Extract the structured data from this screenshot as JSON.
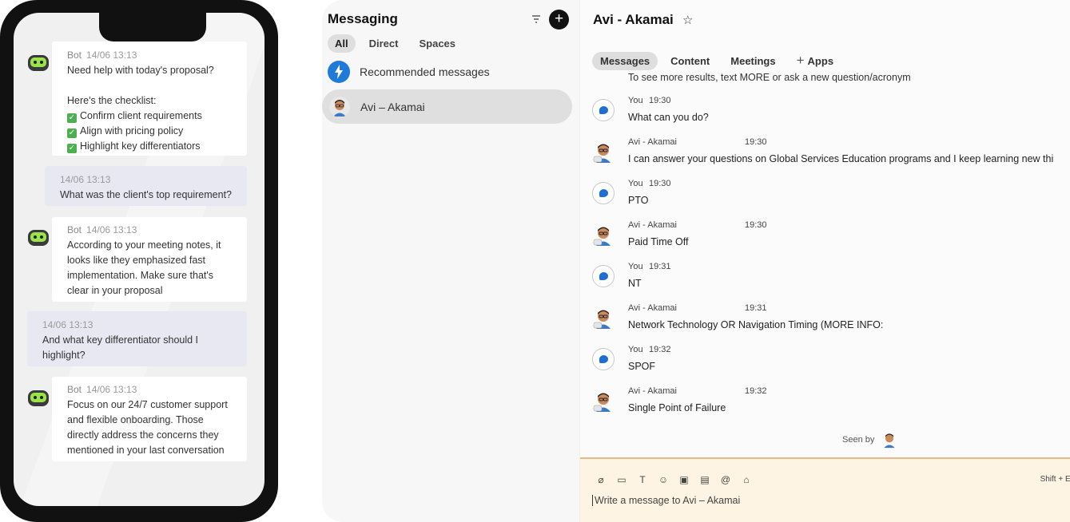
{
  "phone": {
    "messages": [
      {
        "type": "bot",
        "sender": "Bot",
        "time": "14/06 13:13",
        "lines": [
          "Need help with today's proposal?",
          "",
          "Here's the checklist:"
        ],
        "checklist": [
          "Confirm client requirements",
          "Align with pricing policy",
          "Highlight key differentiators"
        ]
      },
      {
        "type": "user",
        "time": "14/06 13:13",
        "lines": [
          "What was the client's top requirement?"
        ]
      },
      {
        "type": "bot",
        "sender": "Bot",
        "time": "14/06 13:13",
        "lines": [
          "According to your meeting notes, it",
          "looks like they emphasized fast",
          "implementation. Make sure that's",
          "clear in your proposal"
        ]
      },
      {
        "type": "user",
        "time": "14/06 13:13",
        "lines": [
          "And what key differentiator should I",
          "highlight?"
        ]
      },
      {
        "type": "bot",
        "sender": "Bot",
        "time": "14/06 13:13",
        "lines": [
          "Focus on our 24/7 customer support",
          "and flexible onboarding. Those",
          "directly address the concerns they",
          "mentioned in your last conversation"
        ]
      }
    ]
  },
  "app": {
    "sidebar": {
      "title": "Messaging",
      "filters": [
        "All",
        "Direct",
        "Spaces"
      ],
      "recommended": "Recommended messages",
      "conversation": "Avi – Akamai"
    },
    "chat": {
      "title": "Avi - Akamai",
      "tabs": [
        "Messages",
        "Content",
        "Meetings",
        "Apps"
      ],
      "truncated_line": "To see more results, text MORE or ask a new question/acronym",
      "messages": [
        {
          "sender": "You",
          "time": "19:30",
          "text": "What can you do?"
        },
        {
          "sender": "Avi - Akamai",
          "time": "19:30",
          "text": "I can answer your questions on Global Services Education programs and I keep learning new thi"
        },
        {
          "sender": "You",
          "time": "19:30",
          "text": "PTO"
        },
        {
          "sender": "Avi - Akamai",
          "time": "19:30",
          "text": "Paid Time Off"
        },
        {
          "sender": "You",
          "time": "19:31",
          "text": "NT"
        },
        {
          "sender": "Avi - Akamai",
          "time": "19:31",
          "text": "Network Technology OR Navigation Timing (MORE INFO:"
        },
        {
          "sender": "You",
          "time": "19:32",
          "text": "SPOF"
        },
        {
          "sender": "Avi - Akamai",
          "time": "19:32",
          "text": "Single Point of Failure"
        }
      ],
      "seen_by": "Seen by",
      "composer_placeholder": "Write a message to Avi – Akamai",
      "composer_hint": "Shift + Ent"
    },
    "colors": {
      "accent": "#1f7ad8",
      "composer_bg": "#fdf4e3",
      "composer_border": "#e9b887"
    }
  }
}
